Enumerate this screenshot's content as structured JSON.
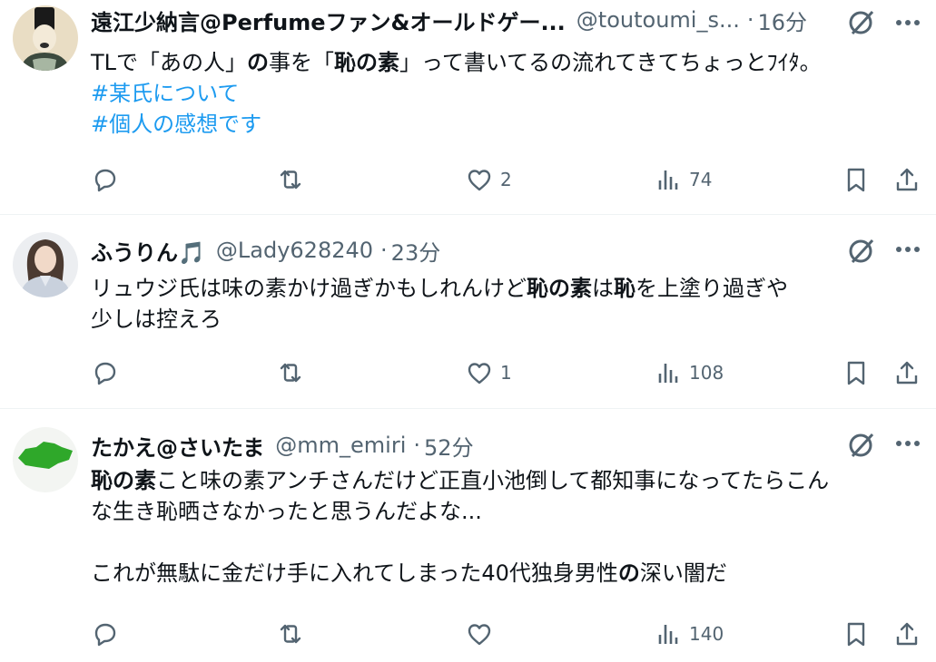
{
  "tweets": [
    {
      "name": "遠江少納言@Perfumeファン&オールドゲー...",
      "handle": "@toutoumi_s...",
      "time": "16分",
      "text_lines": [
        [
          "TLで「あの人」",
          {
            "b": "の"
          },
          "事を「",
          {
            "b": "恥の素"
          },
          "」って書いてるの流れてきてちょっとﾌｲﾀ。"
        ]
      ],
      "hashtags": [
        "#某氏について",
        "#個人の感想です"
      ],
      "reply_count": "",
      "retweet_count": "",
      "like_count": "2",
      "view_count": "74",
      "avatar_icon": "noble-portrait-avatar"
    },
    {
      "name": "ふうりん🎵",
      "handle": "@Lady628240",
      "time": "23分",
      "text_lines": [
        [
          "リュウジ氏は味の素かけ過ぎかもしれんけど",
          {
            "b": "恥の素"
          },
          "は",
          {
            "b": "恥"
          },
          "を上塗り過ぎや"
        ],
        [
          "少しは控えろ"
        ]
      ],
      "hashtags": [],
      "reply_count": "",
      "retweet_count": "",
      "like_count": "1",
      "view_count": "108",
      "avatar_icon": "woman-portrait-avatar"
    },
    {
      "name": "たかえ@さいたま",
      "handle": "@mm_emiri",
      "time": "52分",
      "text_lines": [
        [
          {
            "b": "恥の素"
          },
          "こと味の素アンチさんだけど正直小池倒して都知事になってたらこん"
        ],
        [
          "な生き恥晒さなかったと思うんだよな..."
        ],
        [
          ""
        ],
        [
          "これが無駄に金だけ手に入れてしまった40代独身男性",
          {
            "b": "の"
          },
          "深い闇だ"
        ]
      ],
      "hashtags": [],
      "reply_count": "",
      "retweet_count": "",
      "like_count": "",
      "view_count": "140",
      "avatar_icon": "saitama-map-avatar"
    }
  ],
  "colors": {
    "text": "#0f1419",
    "secondary": "#536471",
    "link": "#1d9bf0",
    "divider": "#eff3f4"
  },
  "icons": [
    "reply-icon",
    "retweet-icon",
    "like-icon",
    "views-icon",
    "bookmark-icon",
    "share-icon",
    "grok-icon",
    "more-icon"
  ]
}
